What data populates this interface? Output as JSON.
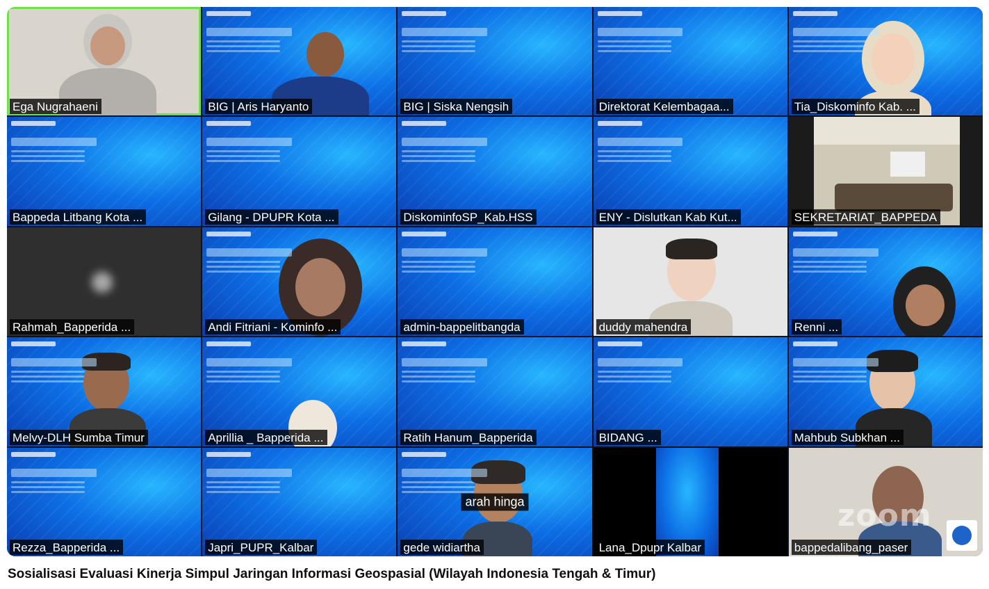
{
  "video": {
    "title": "Sosialisasi Evaluasi Kinerja Simpul Jaringan Informasi Geospasial (Wilayah Indonesia Tengah & Timur)"
  },
  "tiles": [
    {
      "name": "Ega Nugrahaeni",
      "type": "camera",
      "speaking": true
    },
    {
      "name": "BIG | Aris Haryanto",
      "type": "slide-camera"
    },
    {
      "name": "BIG | Siska Nengsih",
      "type": "slide"
    },
    {
      "name": "Direktorat Kelembagaa...",
      "type": "slide"
    },
    {
      "name": "Tia_Diskominfo Kab. ...",
      "type": "slide-avatar"
    },
    {
      "name": "Bappeda Litbang Kota ...",
      "type": "slide"
    },
    {
      "name": "Gilang - DPUPR Kota ...",
      "type": "slide"
    },
    {
      "name": "DiskominfoSP_Kab.HSS",
      "type": "slide"
    },
    {
      "name": "ENY - Dislutkan Kab Kut...",
      "type": "slide"
    },
    {
      "name": "SEKRETARIAT_BAPPEDA",
      "type": "room"
    },
    {
      "name": "Rahmah_Bapperida ...",
      "type": "dark"
    },
    {
      "name": "Andi Fitriani - Kominfo ...",
      "type": "slide-camera"
    },
    {
      "name": "admin-bappelitbangda",
      "type": "slide"
    },
    {
      "name": "duddy mahendra",
      "type": "avatar-light"
    },
    {
      "name": "Renni ...",
      "type": "slide-camera"
    },
    {
      "name": "Melvy-DLH Sumba Timur",
      "type": "slide-avatar"
    },
    {
      "name": "Aprillia _ Bapperida ...",
      "type": "slide-camera"
    },
    {
      "name": "Ratih Hanum_Bapperida",
      "type": "slide"
    },
    {
      "name": "BIDANG ...",
      "type": "slide"
    },
    {
      "name": "Mahbub Subkhan ...",
      "type": "slide-avatar"
    },
    {
      "name": "Rezza_Bapperida ...",
      "type": "slide"
    },
    {
      "name": "Japri_PUPR_Kalbar",
      "type": "slide"
    },
    {
      "name": "gede widiartha",
      "type": "slide-avatar",
      "caption": "arah hinga"
    },
    {
      "name": "Lana_Dpupr Kalbar",
      "type": "black-slide"
    },
    {
      "name": "bappedalibang_paser",
      "type": "office"
    }
  ],
  "colors": {
    "speaking_border": "#6fe04b",
    "slide_blue": "#0d6fe6"
  },
  "zoom_watermark": "zoom"
}
